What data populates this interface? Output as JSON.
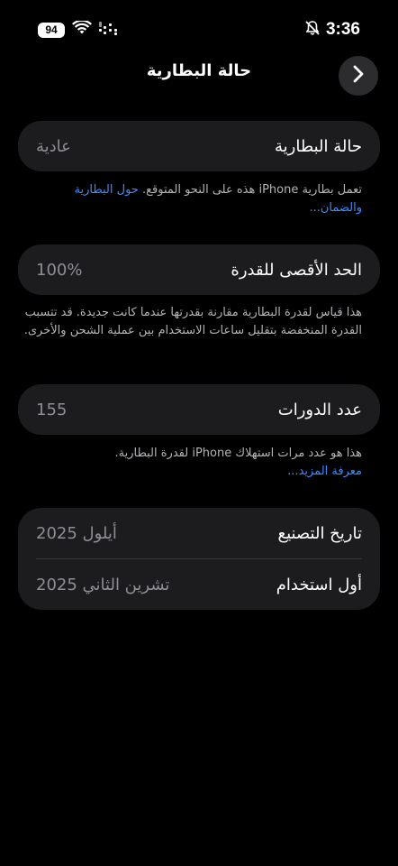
{
  "status_bar": {
    "battery_level": "94",
    "time": "3:36"
  },
  "nav": {
    "title": "حالة البطارية"
  },
  "health": {
    "label": "حالة البطارية",
    "value": "عادية",
    "footnote": "تعمل بطارية iPhone هذه على النحو المتوقع.",
    "link": "حول البطارية والضمان..."
  },
  "capacity": {
    "label": "الحد الأقصى للقدرة",
    "value": "100%",
    "footnote": "هذا قياس لقدرة البطارية مقارنة بقدرتها عندما كانت جديدة. قد تتسبب القدرة المنخفضة بتقليل ساعات الاستخدام بين عملية الشحن والأخرى."
  },
  "cycles": {
    "label": "عدد الدورات",
    "value": "155",
    "footnote": "هذا هو عدد مرات استهلاك iPhone لقدرة البطارية.",
    "link": "معرفة المزيد..."
  },
  "dates": {
    "manufacture_label": "تاريخ التصنيع",
    "manufacture_value": "أيلول 2025",
    "first_use_label": "أول استخدام",
    "first_use_value": "تشرين الثاني 2025"
  },
  "colors": {
    "background": "#000000",
    "card": "#1c1c1e",
    "link": "#3d8bff",
    "secondary_text": "#8e8e93"
  }
}
